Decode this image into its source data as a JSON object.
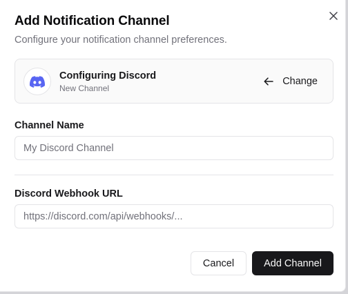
{
  "dialog": {
    "title": "Add Notification Channel",
    "subtitle": "Configure your notification channel preferences."
  },
  "provider": {
    "title": "Configuring Discord",
    "subtitle": "New Channel",
    "change_label": "Change",
    "logo_icon": "discord-icon",
    "brand_color": "#5865F2"
  },
  "fields": {
    "channel_name": {
      "label": "Channel Name",
      "value": "",
      "placeholder": "My Discord Channel"
    },
    "webhook_url": {
      "label": "Discord Webhook URL",
      "value": "",
      "placeholder": "https://discord.com/api/webhooks/..."
    }
  },
  "actions": {
    "cancel_label": "Cancel",
    "submit_label": "Add Channel"
  }
}
